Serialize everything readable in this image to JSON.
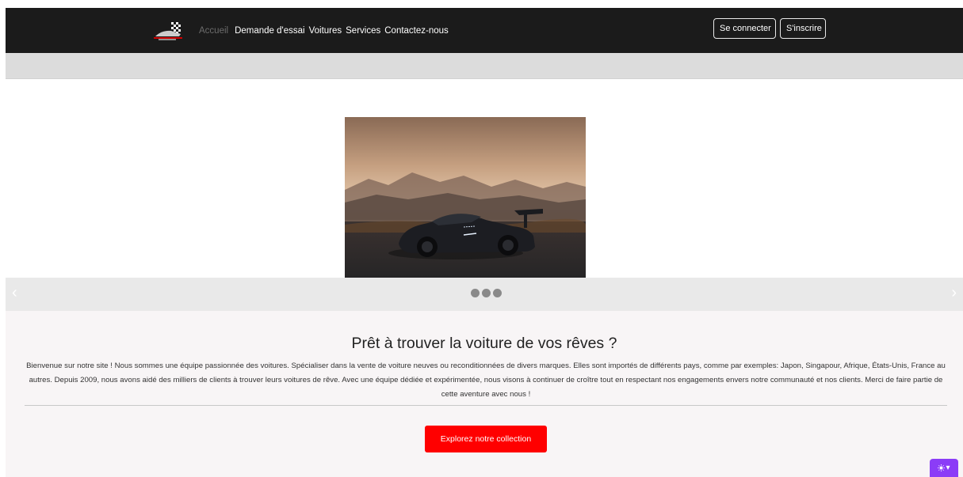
{
  "navbar": {
    "logo_icon": "racing-flag-car-logo",
    "links": [
      {
        "label": "Accueil",
        "active": true
      },
      {
        "label": "Demande d'essai"
      },
      {
        "label": "Voitures"
      },
      {
        "label": "Services"
      },
      {
        "label": "Contactez-nous"
      }
    ],
    "login_label": "Se connecter",
    "signup_label": "S'inscrire"
  },
  "carousel": {
    "image_alt": "Voiture de sport noire au coucher du soleil",
    "prev_label": "‹",
    "next_label": "›",
    "slide_count": 3,
    "active_index": 0
  },
  "about": {
    "title": "Prêt à trouver la voiture de vos rêves ?",
    "text": "Bienvenue sur notre site ! Nous sommes une équipe passionnée des voitures. Spécialiser dans la vente de voiture neuves ou reconditionnées de divers marques. Elles sont importés de différents pays, comme par exemples: Japon, Singapour, Afrique, États-Unis, France au autres. Depuis 2009, nous avons aidé des milliers de clients à trouver leurs voitures de rêve. Avec une équipe dédiée et expérimentée, nous visons à continuer de croître tout en respectant nos engagements envers notre communauté et nos clients. Merci de faire partie de cette aventure avec nous !",
    "cta_label": "Explorez notre collection"
  },
  "theme_toggle": {
    "icon": "sun-icon",
    "caret": "▾"
  },
  "colors": {
    "navbar": "#1b1b1b",
    "cta": "#ff0000",
    "toggle": "#8b3cf7"
  }
}
